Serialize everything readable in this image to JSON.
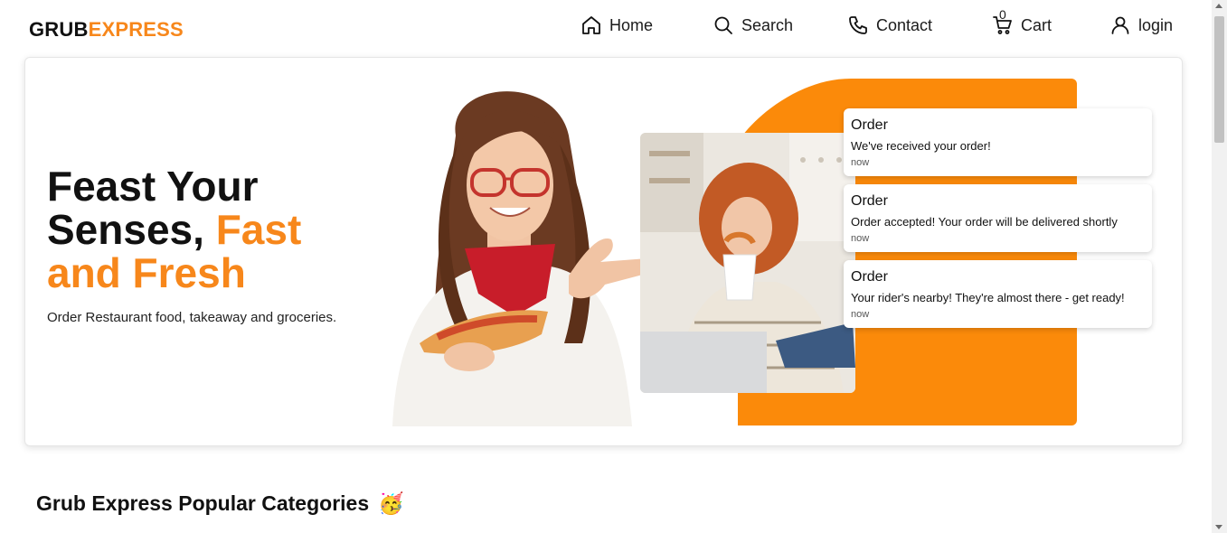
{
  "brand": {
    "part1": "GRUB",
    "part2": "EXPRESS",
    "accent_color": "#f7871b"
  },
  "nav": {
    "home": "Home",
    "search": "Search",
    "contact": "Contact",
    "cart": "Cart",
    "cart_count": "0",
    "login": "login"
  },
  "hero": {
    "headline_1": "Feast Your",
    "headline_2": "Senses,",
    "headline_accent": "Fast and Fresh",
    "subtitle": "Order Restaurant food, takeaway and groceries.",
    "accent_block_color": "#fb8a0a"
  },
  "notifications": [
    {
      "title": "Order",
      "message": "We've received your order!",
      "time": "now"
    },
    {
      "title": "Order",
      "message": "Order accepted! Your order will be delivered shortly",
      "time": "now"
    },
    {
      "title": "Order",
      "message": "Your rider's nearby! They're almost there - get ready!",
      "time": "now"
    }
  ],
  "section": {
    "title": "Grub Express Popular Categories",
    "emoji": "🥳"
  }
}
